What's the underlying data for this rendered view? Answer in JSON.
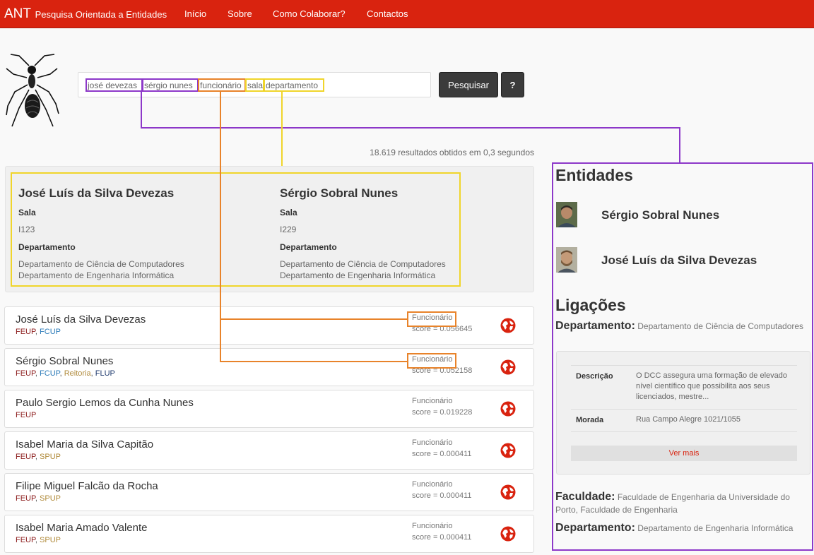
{
  "navbar": {
    "brand": "ANT",
    "subtitle": "Pesquisa Orientada a Entidades",
    "links": [
      "Início",
      "Sobre",
      "Como Colaborar?",
      "Contactos"
    ]
  },
  "search": {
    "tokens": [
      "josé devezas",
      "sérgio nunes",
      "funcionário",
      "sala",
      "departamento"
    ],
    "button": "Pesquisar",
    "help": "?"
  },
  "results_count": "18.619 resultados obtidos em 0,3 segundos",
  "summary": [
    {
      "name": "José Luís da Silva Devezas",
      "sala_label": "Sala",
      "sala": "I123",
      "dept_label": "Departamento",
      "depts": [
        "Departamento de Ciência de Computadores",
        "Departamento de Engenharia Informática"
      ]
    },
    {
      "name": "Sérgio Sobral Nunes",
      "sala_label": "Sala",
      "sala": "I229",
      "dept_label": "Departamento",
      "depts": [
        "Departamento de Ciência de Computadores",
        "Departamento de Engenharia Informática"
      ]
    }
  ],
  "results": [
    {
      "name": "José Luís da Silva Devezas",
      "orgs": [
        {
          "t": "FEUP",
          "c": "#8b1a1a"
        },
        {
          "t": "FCUP",
          "c": "#2a7ab8"
        }
      ],
      "type": "Funcionário",
      "score": "score = 0.056645"
    },
    {
      "name": "Sérgio Sobral Nunes",
      "orgs": [
        {
          "t": "FEUP",
          "c": "#8b1a1a"
        },
        {
          "t": "FCUP",
          "c": "#2a7ab8"
        },
        {
          "t": "Reitoria",
          "c": "#b08a3a"
        },
        {
          "t": "FLUP",
          "c": "#1f3a6e"
        }
      ],
      "type": "Funcionário",
      "score": "score = 0.052158"
    },
    {
      "name": "Paulo Sergio Lemos da Cunha Nunes",
      "orgs": [
        {
          "t": "FEUP",
          "c": "#8b1a1a"
        }
      ],
      "type": "Funcionário",
      "score": "score = 0.019228"
    },
    {
      "name": "Isabel Maria da Silva Capitão",
      "orgs": [
        {
          "t": "FEUP",
          "c": "#8b1a1a"
        },
        {
          "t": "SPUP",
          "c": "#b08a3a"
        }
      ],
      "type": "Funcionário",
      "score": "score = 0.000411"
    },
    {
      "name": "Filipe Miguel Falcão da Rocha",
      "orgs": [
        {
          "t": "FEUP",
          "c": "#8b1a1a"
        },
        {
          "t": "SPUP",
          "c": "#b08a3a"
        }
      ],
      "type": "Funcionário",
      "score": "score = 0.000411"
    },
    {
      "name": "Isabel Maria Amado Valente",
      "orgs": [
        {
          "t": "FEUP",
          "c": "#8b1a1a"
        },
        {
          "t": "SPUP",
          "c": "#b08a3a"
        }
      ],
      "type": "Funcionário",
      "score": "score = 0.000411"
    }
  ],
  "sidebar": {
    "entities_title": "Entidades",
    "entities": [
      "Sérgio Sobral Nunes",
      "José Luís da Silva Devezas"
    ],
    "links_title": "Ligações",
    "dept1_label": "Departamento:",
    "dept1_value": "Departamento de Ciência de Computadores",
    "info": {
      "desc_label": "Descrição",
      "desc_value": "O DCC assegura uma formação de elevado nível científico que possibilita aos seus licenciados, mestre...",
      "addr_label": "Morada",
      "addr_value": "Rua Campo Alegre 1021/1055",
      "more": "Ver mais"
    },
    "fac_label": "Faculdade:",
    "fac_value": "Faculdade de Engenharia da Universidade do Porto, Faculdade de Engenharia",
    "dept2_label": "Departamento:",
    "dept2_value": "Departamento de Engenharia Informática"
  },
  "colors": {
    "brand_red": "#d9230f",
    "purple": "#8d38c9",
    "orange": "#e8832a",
    "yellow": "#f0d52b"
  },
  "icons": [
    "ant-logo-icon",
    "globe-icon",
    "avatar"
  ]
}
